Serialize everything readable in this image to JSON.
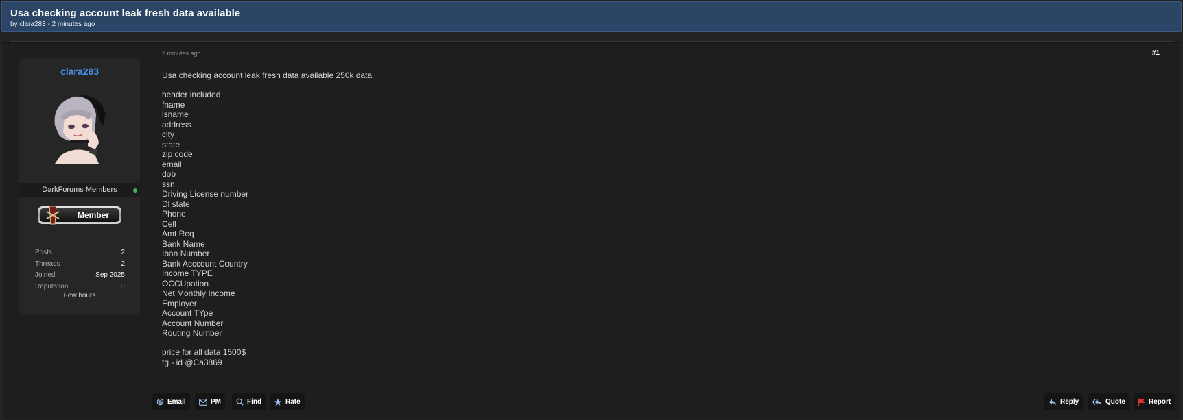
{
  "thread": {
    "title": "Usa checking account leak fresh data available",
    "meta": "by clara283 - 2 minutes ago"
  },
  "user": {
    "username": "clara283",
    "usergroup": "DarkForums Members",
    "rank_label": "Member",
    "stats": [
      {
        "label": "Posts",
        "value": "2"
      },
      {
        "label": "Threads",
        "value": "2"
      },
      {
        "label": "Joined",
        "value": "Sep 2025"
      },
      {
        "label": "Reputation",
        "value": "0"
      }
    ],
    "activity": "Few hours"
  },
  "post": {
    "date": "2 minutes ago",
    "number": "#1",
    "intro": "Usa checking account leak fresh data available 250k data",
    "fields": [
      "header included",
      "fname",
      "lsname",
      "address",
      "city",
      "state",
      "zip code",
      "email",
      "dob",
      "ssn",
      "Driving License number",
      "Dl state",
      "Phone",
      "Cell",
      "Amt Req",
      "Bank Name",
      "Iban Number",
      "Bank Acccount Country",
      "Income TYPE",
      "OCCUpation",
      "Net Monthly Income",
      "Employer",
      "Account TYpe",
      "Account Number",
      "Routing Number"
    ],
    "price": "price for all data 1500$",
    "contact": "tg - id @Ca3869"
  },
  "buttons": {
    "email": "Email",
    "pm": "PM",
    "find": "Find",
    "rate": "Rate",
    "reply": "Reply",
    "quote": "Quote",
    "report": "Report"
  },
  "colors": {
    "header_bg": "#2b4566",
    "username": "#4a90e8",
    "online": "#3fb34f",
    "report_flag": "#e03131"
  }
}
